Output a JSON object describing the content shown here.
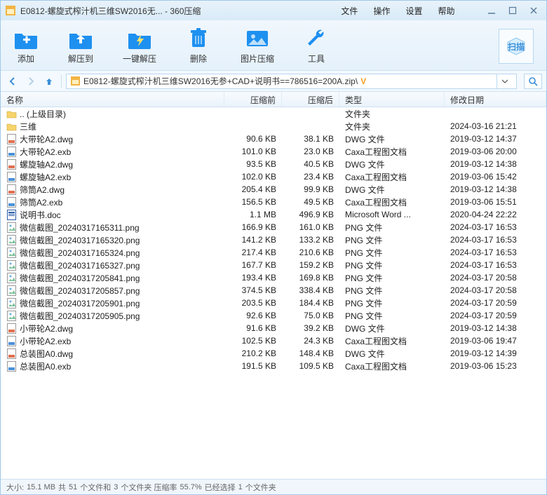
{
  "title": "E0812-螺旋式榨汁机三维SW2016无... - 360压缩",
  "menus": {
    "file": "文件",
    "operate": "操作",
    "settings": "设置",
    "help": "帮助"
  },
  "toolbar": {
    "add": "添加",
    "extractTo": "解压到",
    "oneClick": "一键解压",
    "delete": "删除",
    "imgCompress": "图片压缩",
    "tools": "工具",
    "scan": "扫描"
  },
  "path": "E0812-螺旋式榨汁机三维SW2016无参+CAD+说明书==786516=200A.zip\\",
  "vbadge": "V",
  "columns": {
    "name": "名称",
    "pre": "压缩前",
    "post": "压缩后",
    "type": "类型",
    "date": "修改日期"
  },
  "files": [
    {
      "icon": "folder-up",
      "name": ".. (上级目录)",
      "pre": "",
      "post": "",
      "type": "文件夹",
      "date": ""
    },
    {
      "icon": "folder",
      "name": "三维",
      "pre": "",
      "post": "",
      "type": "文件夹",
      "date": "2024-03-16 21:21"
    },
    {
      "icon": "dwg",
      "name": "大带轮A2.dwg",
      "pre": "90.6 KB",
      "post": "38.1 KB",
      "type": "DWG 文件",
      "date": "2019-03-12 14:37"
    },
    {
      "icon": "exb",
      "name": "大带轮A2.exb",
      "pre": "101.0 KB",
      "post": "23.0 KB",
      "type": "Caxa工程图文档",
      "date": "2019-03-06 20:00"
    },
    {
      "icon": "dwg",
      "name": "螺旋轴A2.dwg",
      "pre": "93.5 KB",
      "post": "40.5 KB",
      "type": "DWG 文件",
      "date": "2019-03-12 14:38"
    },
    {
      "icon": "exb",
      "name": "螺旋轴A2.exb",
      "pre": "102.0 KB",
      "post": "23.4 KB",
      "type": "Caxa工程图文档",
      "date": "2019-03-06 15:42"
    },
    {
      "icon": "dwg",
      "name": "筛筒A2.dwg",
      "pre": "205.4 KB",
      "post": "99.9 KB",
      "type": "DWG 文件",
      "date": "2019-03-12 14:38"
    },
    {
      "icon": "exb",
      "name": "筛筒A2.exb",
      "pre": "156.5 KB",
      "post": "49.5 KB",
      "type": "Caxa工程图文档",
      "date": "2019-03-06 15:51"
    },
    {
      "icon": "doc",
      "name": "说明书.doc",
      "pre": "1.1 MB",
      "post": "496.9 KB",
      "type": "Microsoft Word ...",
      "date": "2020-04-24 22:22"
    },
    {
      "icon": "png",
      "name": "微信截图_20240317165311.png",
      "pre": "166.9 KB",
      "post": "161.0 KB",
      "type": "PNG 文件",
      "date": "2024-03-17 16:53"
    },
    {
      "icon": "png",
      "name": "微信截图_20240317165320.png",
      "pre": "141.2 KB",
      "post": "133.2 KB",
      "type": "PNG 文件",
      "date": "2024-03-17 16:53"
    },
    {
      "icon": "png",
      "name": "微信截图_20240317165324.png",
      "pre": "217.4 KB",
      "post": "210.6 KB",
      "type": "PNG 文件",
      "date": "2024-03-17 16:53"
    },
    {
      "icon": "png",
      "name": "微信截图_20240317165327.png",
      "pre": "167.7 KB",
      "post": "159.2 KB",
      "type": "PNG 文件",
      "date": "2024-03-17 16:53"
    },
    {
      "icon": "png",
      "name": "微信截图_20240317205841.png",
      "pre": "193.4 KB",
      "post": "169.8 KB",
      "type": "PNG 文件",
      "date": "2024-03-17 20:58"
    },
    {
      "icon": "png",
      "name": "微信截图_20240317205857.png",
      "pre": "374.5 KB",
      "post": "338.4 KB",
      "type": "PNG 文件",
      "date": "2024-03-17 20:58"
    },
    {
      "icon": "png",
      "name": "微信截图_20240317205901.png",
      "pre": "203.5 KB",
      "post": "184.4 KB",
      "type": "PNG 文件",
      "date": "2024-03-17 20:59"
    },
    {
      "icon": "png",
      "name": "微信截图_20240317205905.png",
      "pre": "92.6 KB",
      "post": "75.0 KB",
      "type": "PNG 文件",
      "date": "2024-03-17 20:59"
    },
    {
      "icon": "dwg",
      "name": "小带轮A2.dwg",
      "pre": "91.6 KB",
      "post": "39.2 KB",
      "type": "DWG 文件",
      "date": "2019-03-12 14:38"
    },
    {
      "icon": "exb",
      "name": "小带轮A2.exb",
      "pre": "102.5 KB",
      "post": "24.3 KB",
      "type": "Caxa工程图文档",
      "date": "2019-03-06 19:47"
    },
    {
      "icon": "dwg",
      "name": "总装图A0.dwg",
      "pre": "210.2 KB",
      "post": "148.4 KB",
      "type": "DWG 文件",
      "date": "2019-03-12 14:39"
    },
    {
      "icon": "exb",
      "name": "总装图A0.exb",
      "pre": "191.5 KB",
      "post": "109.5 KB",
      "type": "Caxa工程图文档",
      "date": "2019-03-06 15:23"
    }
  ],
  "status": {
    "prefix": "大小: ",
    "size": "15.1 MB",
    "mid1": " 共 ",
    "fcount": "51",
    "mid2": " 个文件和 ",
    "dcount": "3",
    "mid3": " 个文件夹 压缩率 ",
    "ratio": "55.7%",
    "mid4": " 已经选择 ",
    "sel": "1",
    "mid5": " 个文件夹"
  }
}
